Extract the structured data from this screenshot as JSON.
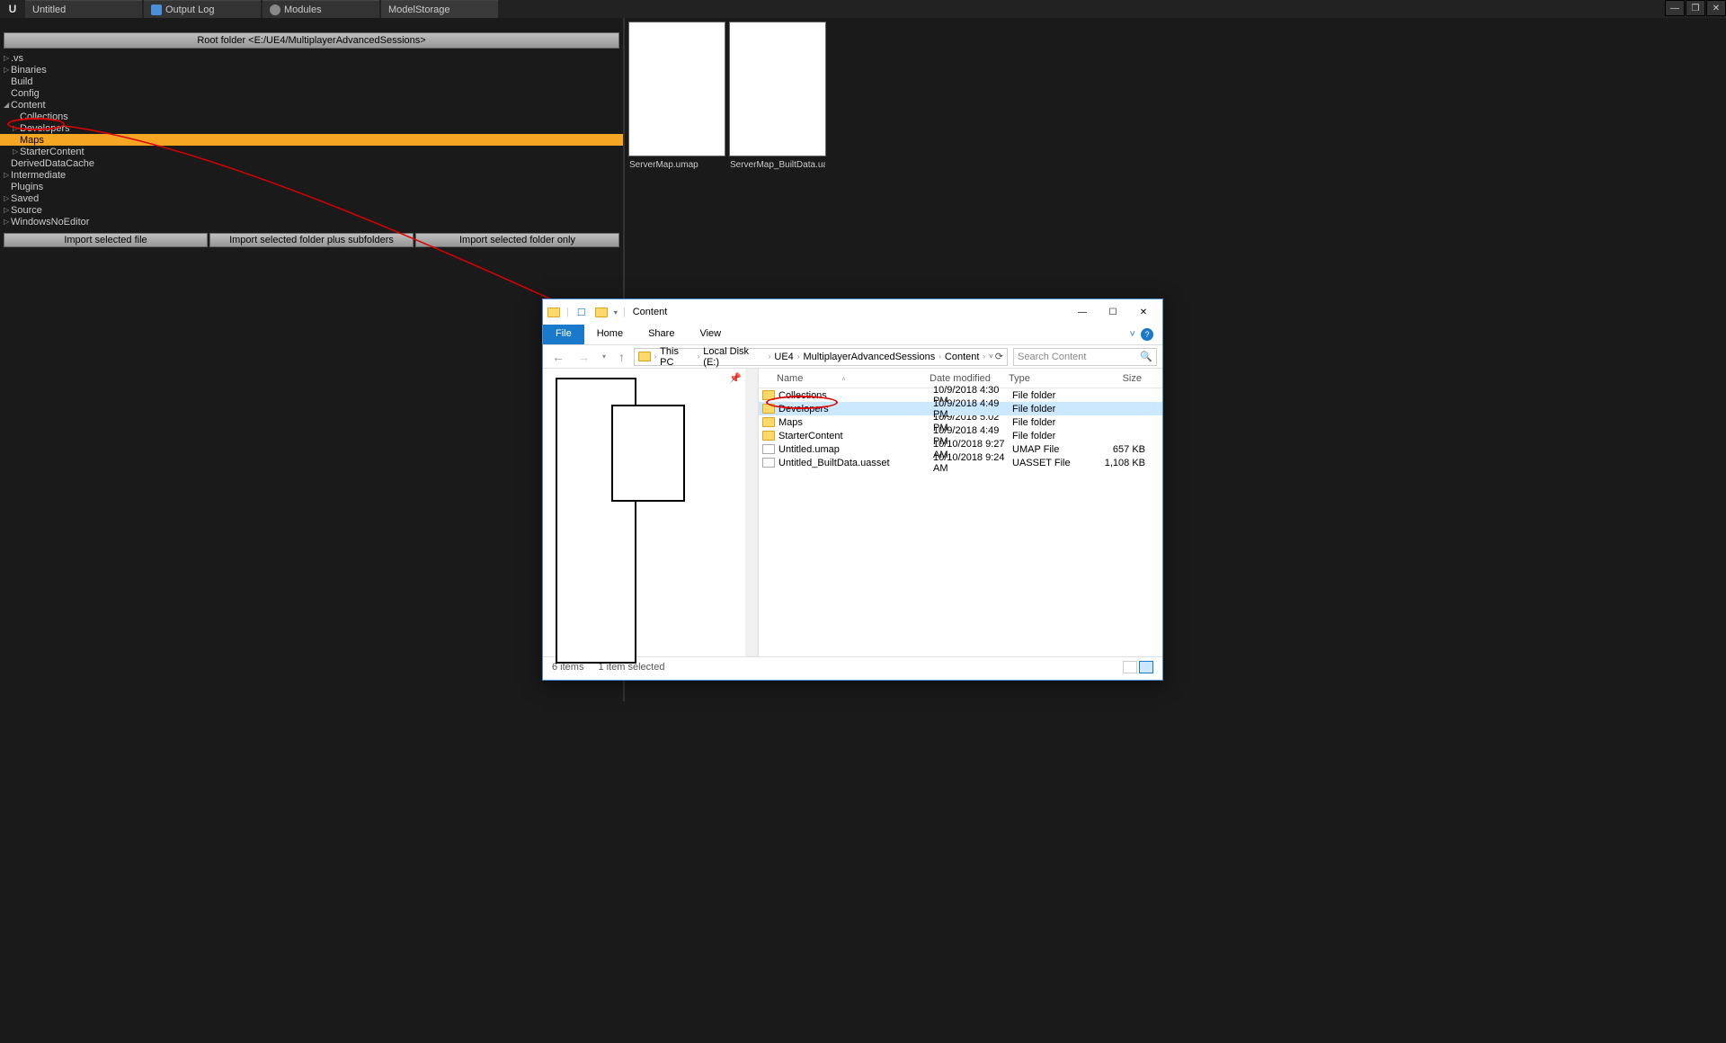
{
  "tabs": [
    "Untitled",
    "Output Log",
    "Modules",
    "ModelStorage"
  ],
  "root_folder_label": "Root folder <E:/UE4/MultiplayerAdvancedSessions>",
  "tree": [
    {
      "label": ".vs",
      "indent": 0,
      "arrow": "▷",
      "selected": false
    },
    {
      "label": "Binaries",
      "indent": 0,
      "arrow": "▷",
      "selected": false
    },
    {
      "label": "Build",
      "indent": 0,
      "arrow": "",
      "selected": false
    },
    {
      "label": "Config",
      "indent": 0,
      "arrow": "",
      "selected": false
    },
    {
      "label": "Content",
      "indent": 0,
      "arrow": "◢",
      "selected": false
    },
    {
      "label": "Collections",
      "indent": 1,
      "arrow": "",
      "selected": false
    },
    {
      "label": "Developers",
      "indent": 1,
      "arrow": "▷",
      "selected": false,
      "circled": true
    },
    {
      "label": "Maps",
      "indent": 1,
      "arrow": "",
      "selected": true
    },
    {
      "label": "StarterContent",
      "indent": 1,
      "arrow": "▷",
      "selected": false
    },
    {
      "label": "DerivedDataCache",
      "indent": 0,
      "arrow": "",
      "selected": false
    },
    {
      "label": "Intermediate",
      "indent": 0,
      "arrow": "▷",
      "selected": false
    },
    {
      "label": "Plugins",
      "indent": 0,
      "arrow": "",
      "selected": false
    },
    {
      "label": "Saved",
      "indent": 0,
      "arrow": "▷",
      "selected": false
    },
    {
      "label": "Source",
      "indent": 0,
      "arrow": "▷",
      "selected": false
    },
    {
      "label": "WindowsNoEditor",
      "indent": 0,
      "arrow": "▷",
      "selected": false
    }
  ],
  "import_buttons": {
    "file": "Import selected file",
    "folder_sub": "Import selected folder plus subfolders",
    "folder_only": "Import selected folder only"
  },
  "thumbnails": [
    "ServerMap.umap",
    "ServerMap_BuiltData.uasset"
  ],
  "explorer": {
    "title": "Content",
    "ribbon_tabs": [
      "File",
      "Home",
      "Share",
      "View"
    ],
    "breadcrumbs": [
      "This PC",
      "Local Disk (E:)",
      "UE4",
      "MultiplayerAdvancedSessions",
      "Content"
    ],
    "search_placeholder": "Search Content",
    "columns": {
      "name": "Name",
      "date": "Date modified",
      "type": "Type",
      "size": "Size"
    },
    "rows": [
      {
        "name": "Collections",
        "date": "10/9/2018 4:30 PM",
        "type": "File folder",
        "size": "",
        "icon": "folder",
        "selected": false
      },
      {
        "name": "Developers",
        "date": "10/9/2018 4:49 PM",
        "type": "File folder",
        "size": "",
        "icon": "folder",
        "selected": true,
        "circled": true
      },
      {
        "name": "Maps",
        "date": "10/9/2018 5:02 PM",
        "type": "File folder",
        "size": "",
        "icon": "folder",
        "selected": false
      },
      {
        "name": "StarterContent",
        "date": "10/9/2018 4:49 PM",
        "type": "File folder",
        "size": "",
        "icon": "folder",
        "selected": false
      },
      {
        "name": "Untitled.umap",
        "date": "10/10/2018 9:27 AM",
        "type": "UMAP File",
        "size": "657 KB",
        "icon": "file",
        "selected": false
      },
      {
        "name": "Untitled_BuiltData.uasset",
        "date": "10/10/2018 9:24 AM",
        "type": "UASSET File",
        "size": "1,108 KB",
        "icon": "file",
        "selected": false
      }
    ],
    "status": {
      "items": "6 items",
      "selected": "1 item selected"
    }
  }
}
